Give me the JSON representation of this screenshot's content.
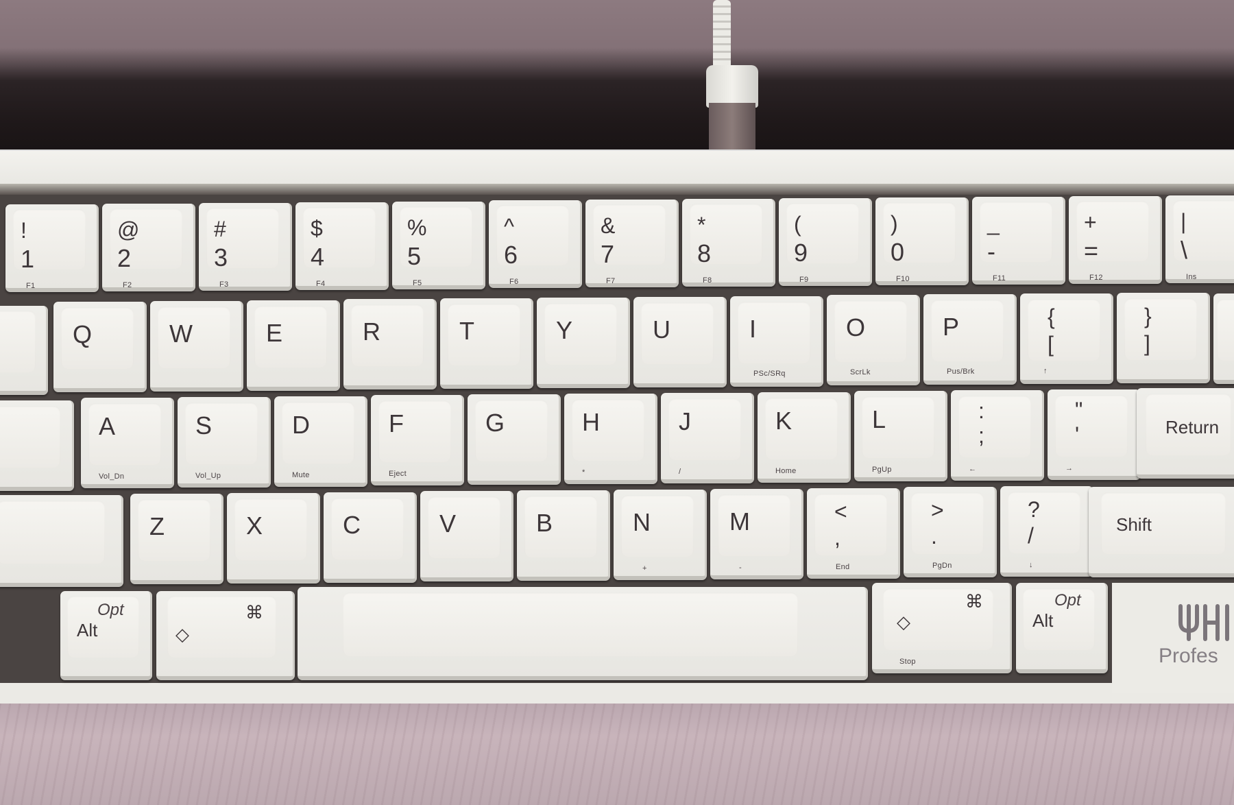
{
  "keyboard": {
    "number_row": [
      {
        "top": "!",
        "bottom": "1",
        "fn": "F1"
      },
      {
        "top": "@",
        "bottom": "2",
        "fn": "F2"
      },
      {
        "top": "#",
        "bottom": "3",
        "fn": "F3"
      },
      {
        "top": "$",
        "bottom": "4",
        "fn": "F4"
      },
      {
        "top": "%",
        "bottom": "5",
        "fn": "F5"
      },
      {
        "top": "^",
        "bottom": "6",
        "fn": "F6"
      },
      {
        "top": "&",
        "bottom": "7",
        "fn": "F7"
      },
      {
        "top": "*",
        "bottom": "8",
        "fn": "F8"
      },
      {
        "top": "(",
        "bottom": "9",
        "fn": "F9"
      },
      {
        "top": ")",
        "bottom": "0",
        "fn": "F10"
      },
      {
        "top": "_",
        "bottom": "-",
        "fn": "F11"
      },
      {
        "top": "+",
        "bottom": "=",
        "fn": "F12"
      },
      {
        "top": "|",
        "bottom": "\\",
        "fn": "Ins"
      }
    ],
    "qwerty_row": [
      {
        "label": "Q",
        "fn": ""
      },
      {
        "label": "W",
        "fn": ""
      },
      {
        "label": "E",
        "fn": ""
      },
      {
        "label": "R",
        "fn": ""
      },
      {
        "label": "T",
        "fn": ""
      },
      {
        "label": "Y",
        "fn": ""
      },
      {
        "label": "U",
        "fn": ""
      },
      {
        "label": "I",
        "fn": "PSc/SRq"
      },
      {
        "label": "O",
        "fn": "ScrLk"
      },
      {
        "label": "P",
        "fn": "Pus/Brk"
      },
      {
        "top": "{",
        "bottom": "[",
        "fn": "↑"
      },
      {
        "top": "}",
        "bottom": "]",
        "fn": ""
      }
    ],
    "home_row": [
      {
        "label": "A",
        "fn": "Vol_Dn"
      },
      {
        "label": "S",
        "fn": "Vol_Up"
      },
      {
        "label": "D",
        "fn": "Mute"
      },
      {
        "label": "F",
        "fn": "Eject"
      },
      {
        "label": "G",
        "fn": ""
      },
      {
        "label": "H",
        "fn": "*"
      },
      {
        "label": "J",
        "fn": "/"
      },
      {
        "label": "K",
        "fn": "Home"
      },
      {
        "label": "L",
        "fn": "PgUp"
      },
      {
        "top": ":",
        "bottom": ";",
        "fn": "←"
      },
      {
        "top": "\"",
        "bottom": "'",
        "fn": "→"
      }
    ],
    "return_label": "Return",
    "bottom_row": [
      {
        "label": "Z",
        "fn": ""
      },
      {
        "label": "X",
        "fn": ""
      },
      {
        "label": "C",
        "fn": ""
      },
      {
        "label": "V",
        "fn": ""
      },
      {
        "label": "B",
        "fn": ""
      },
      {
        "label": "N",
        "fn": "+"
      },
      {
        "label": "M",
        "fn": "-"
      },
      {
        "top": "<",
        "bottom": ",",
        "fn": "End"
      },
      {
        "top": ">",
        "bottom": ".",
        "fn": "PgDn"
      },
      {
        "top": "?",
        "bottom": "/",
        "fn": "↓"
      }
    ],
    "shift_label": "Shift",
    "modifiers": {
      "alt_label": "Alt",
      "opt_label": "Opt",
      "diamond_symbol": "◇",
      "command_symbol": "⌘",
      "stop_label": "Stop"
    },
    "brand": "Profes"
  },
  "colors": {
    "keycap": "#e9e8e3",
    "legend": "#3d3639",
    "case": "#ebeae5",
    "desk": "#c3afb6"
  },
  "icons": [
    "usb-cable-icon",
    "hhkb-logo-icon"
  ]
}
